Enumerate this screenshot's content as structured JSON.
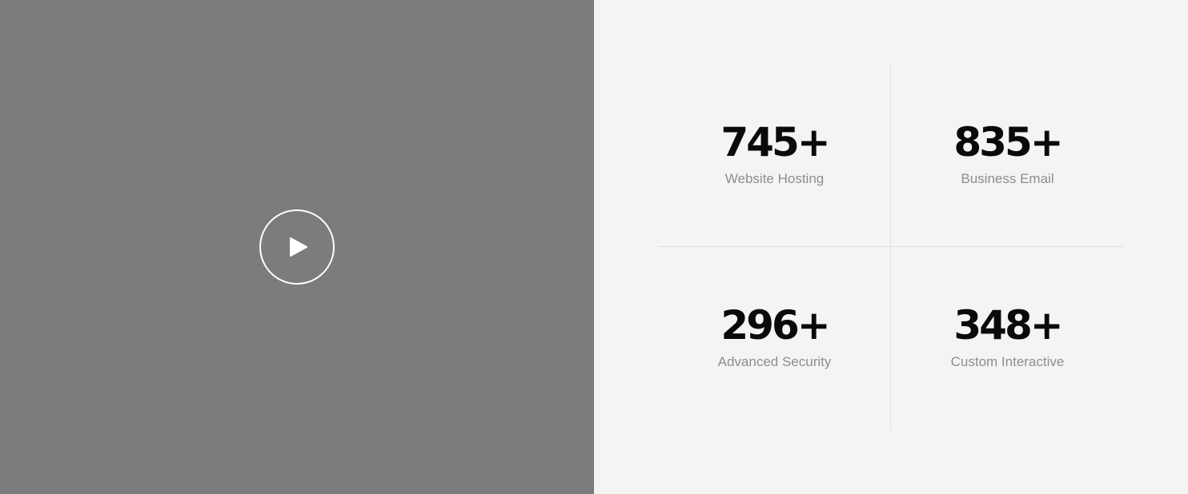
{
  "video": {
    "play_icon": "play-icon",
    "background_color": "#7c7c7e"
  },
  "stats": {
    "items": [
      {
        "value": "745+",
        "label": "Website Hosting"
      },
      {
        "value": "835+",
        "label": "Business Email"
      },
      {
        "value": "296+",
        "label": "Advanced Security"
      },
      {
        "value": "348+",
        "label": "Custom Interactive"
      }
    ],
    "background_color": "#f4f4f4",
    "divider_color": "#dedede",
    "value_color": "#0a0a0a",
    "label_color": "#8e8e8e"
  }
}
